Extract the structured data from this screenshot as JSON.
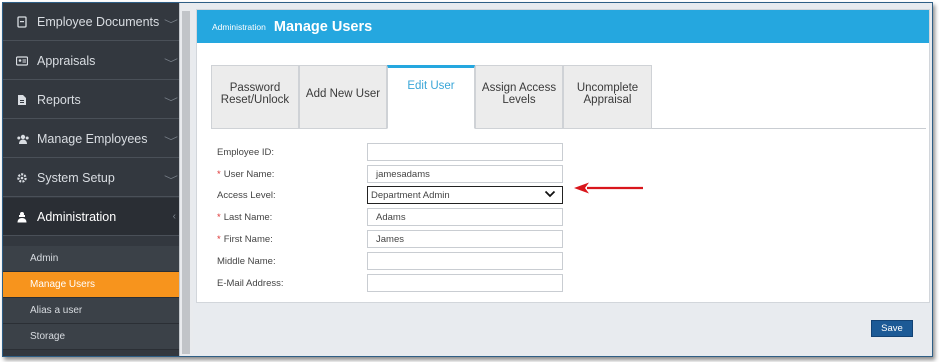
{
  "sidebar": {
    "items": [
      {
        "label": "Employee Documents",
        "icon": "document-icon"
      },
      {
        "label": "Appraisals",
        "icon": "id-card-icon"
      },
      {
        "label": "Reports",
        "icon": "report-icon"
      },
      {
        "label": "Manage Employees",
        "icon": "users-icon"
      },
      {
        "label": "System Setup",
        "icon": "gear-icon"
      },
      {
        "label": "Administration",
        "icon": "admin-icon"
      }
    ],
    "subitems": [
      {
        "label": "Admin"
      },
      {
        "label": "Manage Users"
      },
      {
        "label": "Alias a user"
      },
      {
        "label": "Storage"
      }
    ]
  },
  "header": {
    "breadcrumb": "Administration",
    "title": "Manage Users"
  },
  "tabs": [
    {
      "line1": "Password",
      "line2": "Reset/Unlock"
    },
    {
      "line1": "Add New User",
      "line2": ""
    },
    {
      "line1": "Edit User",
      "line2": ""
    },
    {
      "line1": "Assign Access",
      "line2": "Levels"
    },
    {
      "line1": "Uncomplete",
      "line2": "Appraisal"
    }
  ],
  "form": {
    "employee_id": {
      "label": "Employee ID:",
      "value": ""
    },
    "user_name": {
      "label": "User Name:",
      "value": "jamesadams"
    },
    "access_level": {
      "label": "Access Level:",
      "value": "Department Admin"
    },
    "last_name": {
      "label": "Last Name:",
      "value": "Adams"
    },
    "first_name": {
      "label": "First Name:",
      "value": "James"
    },
    "middle_name": {
      "label": "Middle Name:",
      "value": ""
    },
    "email": {
      "label": "E-Mail Address:",
      "value": ""
    },
    "required_marker": "*"
  },
  "footer": {
    "save_label": "Save"
  },
  "colors": {
    "header": "#25a7df",
    "sidebar": "#33383f",
    "active_subitem": "#f7941d",
    "save_button": "#1c5a96",
    "annotation_arrow": "#d9161c"
  }
}
